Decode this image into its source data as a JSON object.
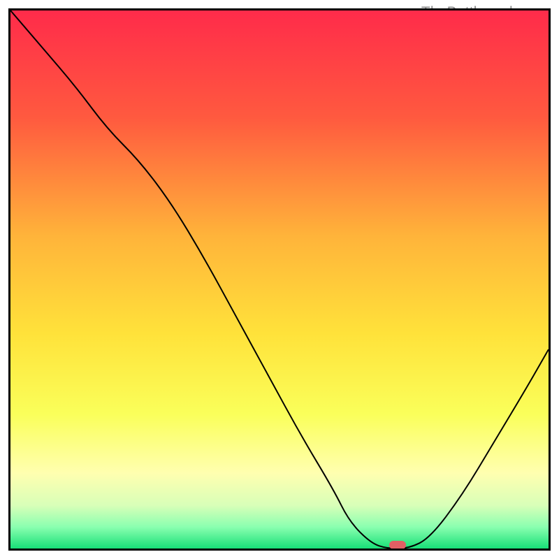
{
  "watermark": "TheBottleneck.com",
  "colors": {
    "top": "#ff2b4a",
    "mid_upper": "#ff8a3a",
    "mid": "#ffd53a",
    "mid_lower": "#f6ff66",
    "pale_yellow": "#ffffc0",
    "pale_green": "#b8ffc9",
    "bottom": "#17e077",
    "marker": "#e15f64",
    "border": "#000000"
  },
  "chart_data": {
    "type": "line",
    "title": "",
    "xlabel": "",
    "ylabel": "",
    "xlim": [
      0,
      100
    ],
    "ylim": [
      0,
      100
    ],
    "series": [
      {
        "name": "bottleneck-curve",
        "x": [
          0,
          6,
          12,
          18,
          24,
          30,
          36,
          42,
          48,
          54,
          60,
          63,
          67,
          70,
          74,
          78,
          84,
          90,
          96,
          100
        ],
        "values": [
          100,
          93,
          86,
          78,
          72,
          64,
          54,
          43,
          32,
          21,
          11,
          5,
          1,
          0,
          0,
          2,
          10,
          20,
          30,
          37
        ]
      }
    ],
    "marker": {
      "x": 72,
      "y": 0.7
    },
    "gradient_stops": [
      {
        "pos": 0.0,
        "color": "#ff2b4a"
      },
      {
        "pos": 0.2,
        "color": "#ff5a3f"
      },
      {
        "pos": 0.42,
        "color": "#ffb43a"
      },
      {
        "pos": 0.6,
        "color": "#ffe23a"
      },
      {
        "pos": 0.75,
        "color": "#faff5a"
      },
      {
        "pos": 0.86,
        "color": "#ffffb0"
      },
      {
        "pos": 0.92,
        "color": "#d8ffb8"
      },
      {
        "pos": 0.96,
        "color": "#8affb0"
      },
      {
        "pos": 1.0,
        "color": "#17e077"
      }
    ]
  }
}
